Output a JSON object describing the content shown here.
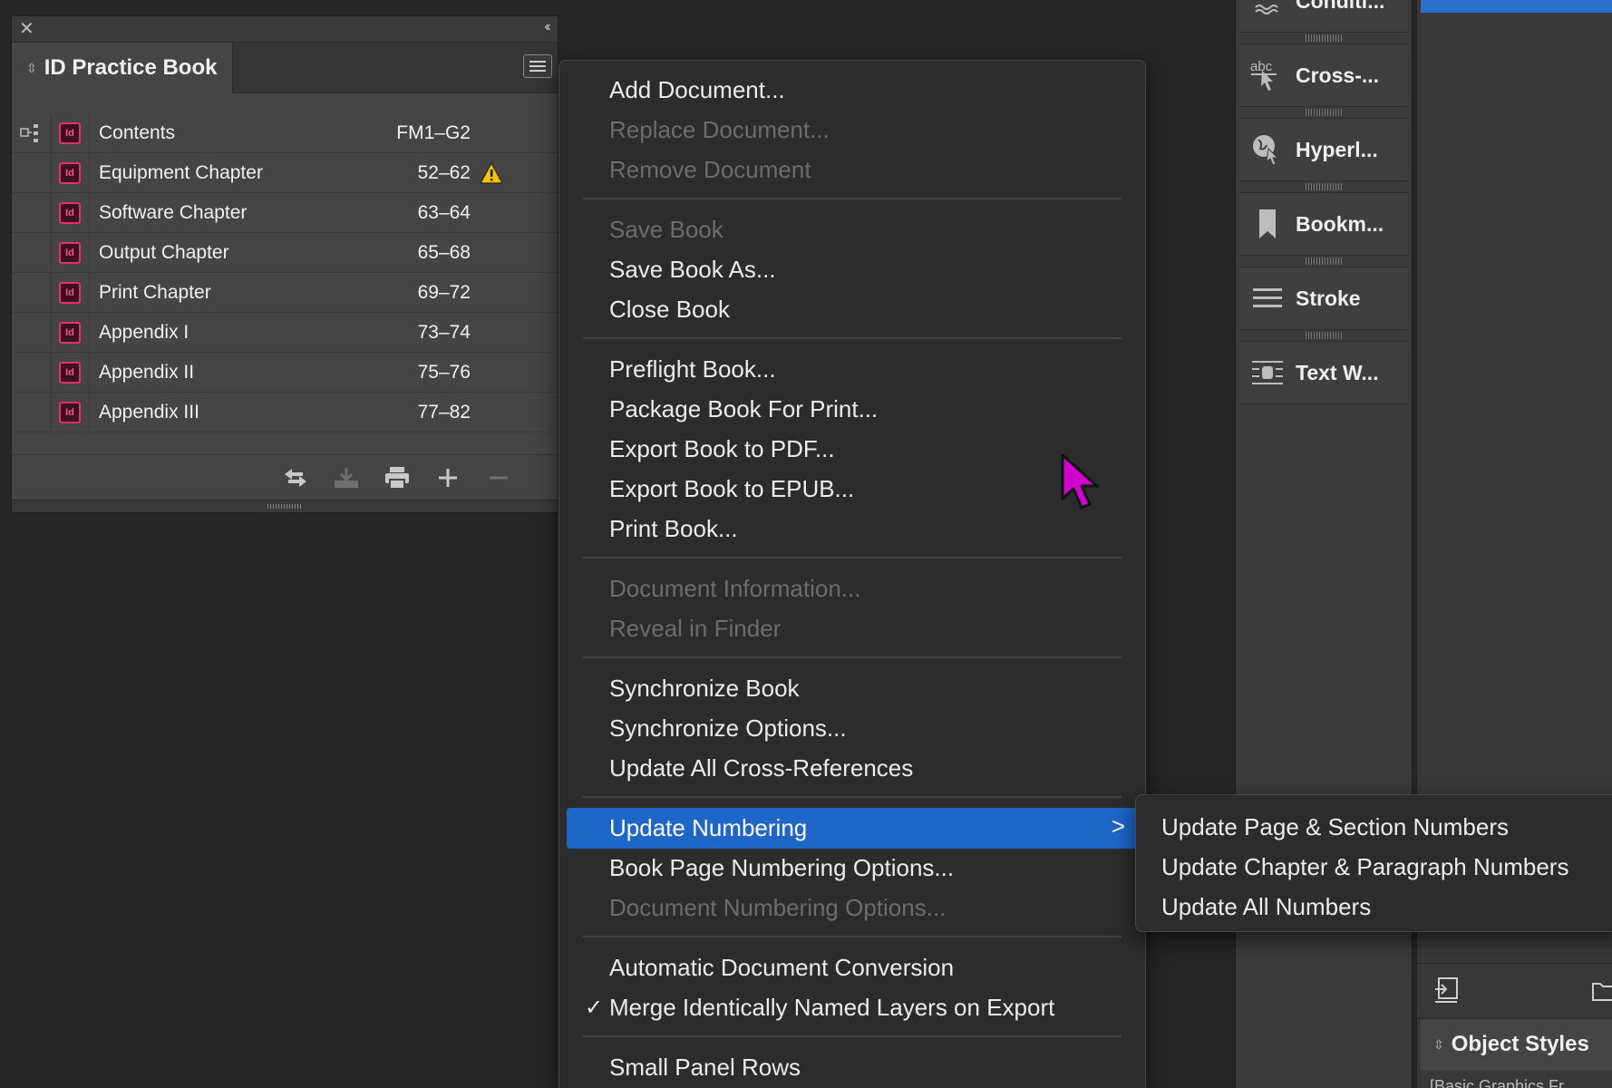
{
  "book_panel": {
    "close_glyph": "✕",
    "collapse_glyph": "‹‹",
    "tab_title": "ID Practice Book",
    "rows": [
      {
        "name": "Contents",
        "pages": "FM1–G2",
        "warning": false
      },
      {
        "name": "Equipment Chapter",
        "pages": "52–62",
        "warning": true
      },
      {
        "name": "Software Chapter",
        "pages": "63–64",
        "warning": false
      },
      {
        "name": "Output Chapter",
        "pages": "65–68",
        "warning": false
      },
      {
        "name": "Print Chapter",
        "pages": "69–72",
        "warning": false
      },
      {
        "name": "Appendix I",
        "pages": "73–74",
        "warning": false
      },
      {
        "name": "Appendix II",
        "pages": "75–76",
        "warning": false
      },
      {
        "name": "Appendix III",
        "pages": "77–82",
        "warning": false
      }
    ],
    "doc_icon_label": "Id",
    "footer_buttons": [
      "sync-icon",
      "save-icon",
      "print-icon",
      "add-icon",
      "remove-icon"
    ]
  },
  "menu": {
    "items": [
      {
        "label": "Add Document...",
        "disabled": false
      },
      {
        "label": "Replace Document...",
        "disabled": true
      },
      {
        "label": "Remove Document",
        "disabled": true
      },
      {
        "label": "Save Book",
        "disabled": true
      },
      {
        "label": "Save Book As...",
        "disabled": false
      },
      {
        "label": "Close Book",
        "disabled": false
      },
      {
        "label": "Preflight Book...",
        "disabled": false
      },
      {
        "label": "Package Book For Print...",
        "disabled": false
      },
      {
        "label": "Export Book to PDF...",
        "disabled": false
      },
      {
        "label": "Export Book to EPUB...",
        "disabled": false
      },
      {
        "label": "Print Book...",
        "disabled": false
      },
      {
        "label": "Document Information...",
        "disabled": true
      },
      {
        "label": "Reveal in Finder",
        "disabled": true
      },
      {
        "label": "Synchronize Book",
        "disabled": false
      },
      {
        "label": "Synchronize Options...",
        "disabled": false
      },
      {
        "label": "Update All Cross-References",
        "disabled": false
      },
      {
        "label": "Update Numbering",
        "disabled": false,
        "active": true,
        "submenu": true
      },
      {
        "label": "Book Page Numbering Options...",
        "disabled": false
      },
      {
        "label": "Document Numbering Options...",
        "disabled": true
      },
      {
        "label": "Automatic Document Conversion",
        "disabled": false
      },
      {
        "label": "Merge Identically Named Layers on Export",
        "disabled": false,
        "checked": true
      },
      {
        "label": "Small Panel Rows",
        "disabled": false
      }
    ],
    "submenu_chevron": ">",
    "check_glyph": "✓"
  },
  "submenu": {
    "items": [
      "Update Page & Section Numbers",
      "Update Chapter & Paragraph Numbers",
      "Update All Numbers"
    ]
  },
  "dock": {
    "items": [
      {
        "label": "Conditi...",
        "icon": "conditional-text-icon"
      },
      {
        "label": "Cross-...",
        "icon": "cross-references-icon"
      },
      {
        "label": "Hyperl...",
        "icon": "hyperlinks-icon"
      },
      {
        "label": "Bookm...",
        "icon": "bookmarks-icon"
      },
      {
        "label": "Stroke",
        "icon": "stroke-icon"
      },
      {
        "label": "Text W...",
        "icon": "text-wrap-icon"
      }
    ]
  },
  "far_panel": {
    "tab_title": "Object Styles",
    "cut_text": "[Basic Graphics Fr..."
  },
  "colors": {
    "menu_highlight": "#1e66c8",
    "id_icon": "#e8306d",
    "cursor": "#d000d0",
    "warning": "#f3c300"
  }
}
